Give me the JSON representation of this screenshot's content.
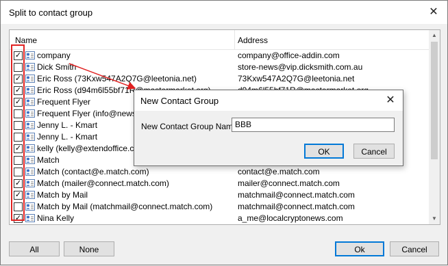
{
  "window": {
    "title": "Split to contact group",
    "close_glyph": "✕"
  },
  "columns": {
    "name": "Name",
    "address": "Address"
  },
  "rows": [
    {
      "checked": true,
      "name": "company",
      "address": "company@office-addin.com"
    },
    {
      "checked": false,
      "name": "Dick Smith",
      "address": "store-news@vip.dicksmith.com.au"
    },
    {
      "checked": true,
      "name": "Eric Ross (73Kxw547A2Q7G@leetonia.net)",
      "address": "73Kxw547A2Q7G@leetonia.net"
    },
    {
      "checked": true,
      "name": "Eric Ross (d94m6l55bf71R@mastermarket.org)",
      "address": "d94m6l55bf71R@mastermarket.org"
    },
    {
      "checked": true,
      "name": "Frequent Flyer",
      "address": ""
    },
    {
      "checked": false,
      "name": "Frequent Flyer (info@news.w",
      "address": ""
    },
    {
      "checked": false,
      "name": "Jenny L. - Kmart",
      "address": ""
    },
    {
      "checked": false,
      "name": "Jenny L. - Kmart",
      "address": ""
    },
    {
      "checked": true,
      "name": "kelly (kelly@extendoffice.com",
      "address": ""
    },
    {
      "checked": false,
      "name": "Match",
      "address": ""
    },
    {
      "checked": false,
      "name": "Match (contact@e.match.com)",
      "address": "contact@e.match.com"
    },
    {
      "checked": true,
      "name": "Match (mailer@connect.match.com)",
      "address": "mailer@connect.match.com"
    },
    {
      "checked": true,
      "name": "Match by Mail",
      "address": "matchmail@connect.match.com"
    },
    {
      "checked": false,
      "name": "Match by Mail (matchmail@connect.match.com)",
      "address": "matchmail@connect.match.com"
    },
    {
      "checked": true,
      "name": "Nina Kelly",
      "address": "a_me@localcryptonews.com"
    }
  ],
  "buttons": {
    "all": "All",
    "none": "None",
    "ok": "Ok",
    "cancel": "Cancel"
  },
  "scroll": {
    "up": "▲",
    "down": "▼"
  },
  "dialog": {
    "title": "New Contact Group",
    "close_glyph": "✕",
    "label": "New Contact Group Name:",
    "value": "BBB",
    "ok": "OK",
    "cancel": "Cancel"
  },
  "colors": {
    "highlight": "#e02020",
    "accent": "#0078d7"
  }
}
